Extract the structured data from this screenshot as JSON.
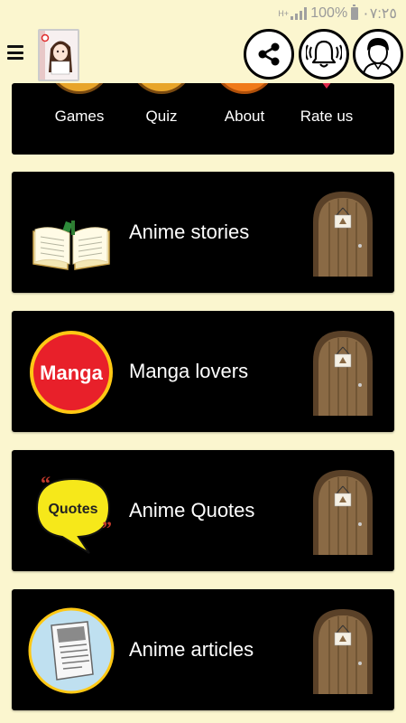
{
  "status_bar": {
    "network": "H+",
    "battery": "100%",
    "time": "٠٧:٢٥"
  },
  "app_bar": {
    "menu_icon": "menu-icon",
    "logo_icon": "anime-book-logo-icon",
    "share_icon": "share-icon",
    "notifications_icon": "bell-icon",
    "profile_icon": "user-avatar-icon"
  },
  "top_menu": {
    "items": [
      {
        "label": "Games",
        "accent": "#e8a52a"
      },
      {
        "label": "Quiz",
        "accent": "#e8a52a"
      },
      {
        "label": "About",
        "accent": "#f07a1a"
      },
      {
        "label": "Rate us",
        "accent": "#e02a4a"
      }
    ]
  },
  "cards": [
    {
      "title": "Anime stories",
      "icon": "open-book-icon"
    },
    {
      "title": "Manga lovers",
      "icon": "manga-badge-icon",
      "badge_text": "Manga",
      "badge_color": "#e8202a"
    },
    {
      "title": "Anime Quotes",
      "icon": "quotes-bubble-icon",
      "badge_text": "Quotes",
      "badge_color": "#f6e81a"
    },
    {
      "title": "Anime articles",
      "icon": "newspaper-icon",
      "badge_color": "#bfe0f0"
    }
  ],
  "colors": {
    "background": "#fbf6cf",
    "card": "#000000",
    "door_wood": "#8a6a45"
  }
}
